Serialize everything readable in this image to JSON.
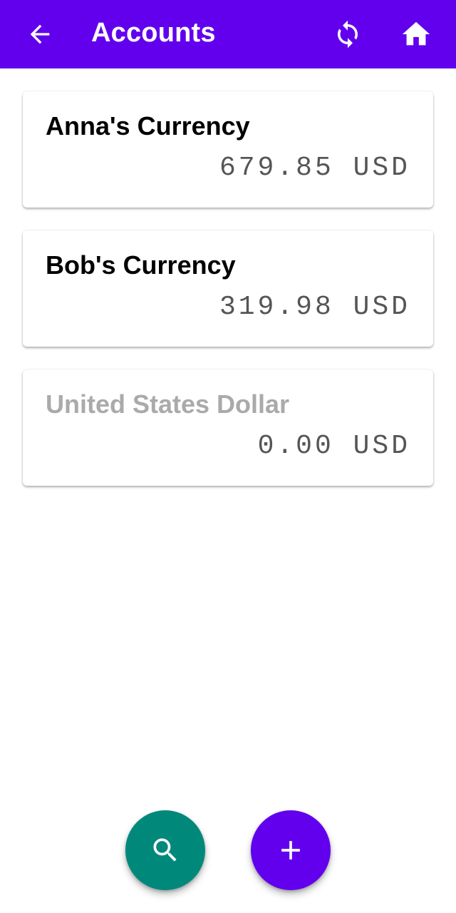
{
  "header": {
    "title": "Accounts",
    "back_icon": "arrow-left-icon",
    "sync_icon": "sync-icon",
    "home_icon": "home-icon"
  },
  "accounts": [
    {
      "name": "Anna's Currency",
      "amount": "679.85 USD",
      "disabled": false
    },
    {
      "name": "Bob's Currency",
      "amount": "319.98 USD",
      "disabled": false
    },
    {
      "name": "United States Dollar",
      "amount": "0.00 USD",
      "disabled": true
    }
  ],
  "fabs": {
    "search_icon": "search-icon",
    "add_icon": "plus-icon"
  },
  "colors": {
    "primary": "#6200ee",
    "secondary": "#00897b",
    "disabled_text": "#aaaaaa"
  }
}
